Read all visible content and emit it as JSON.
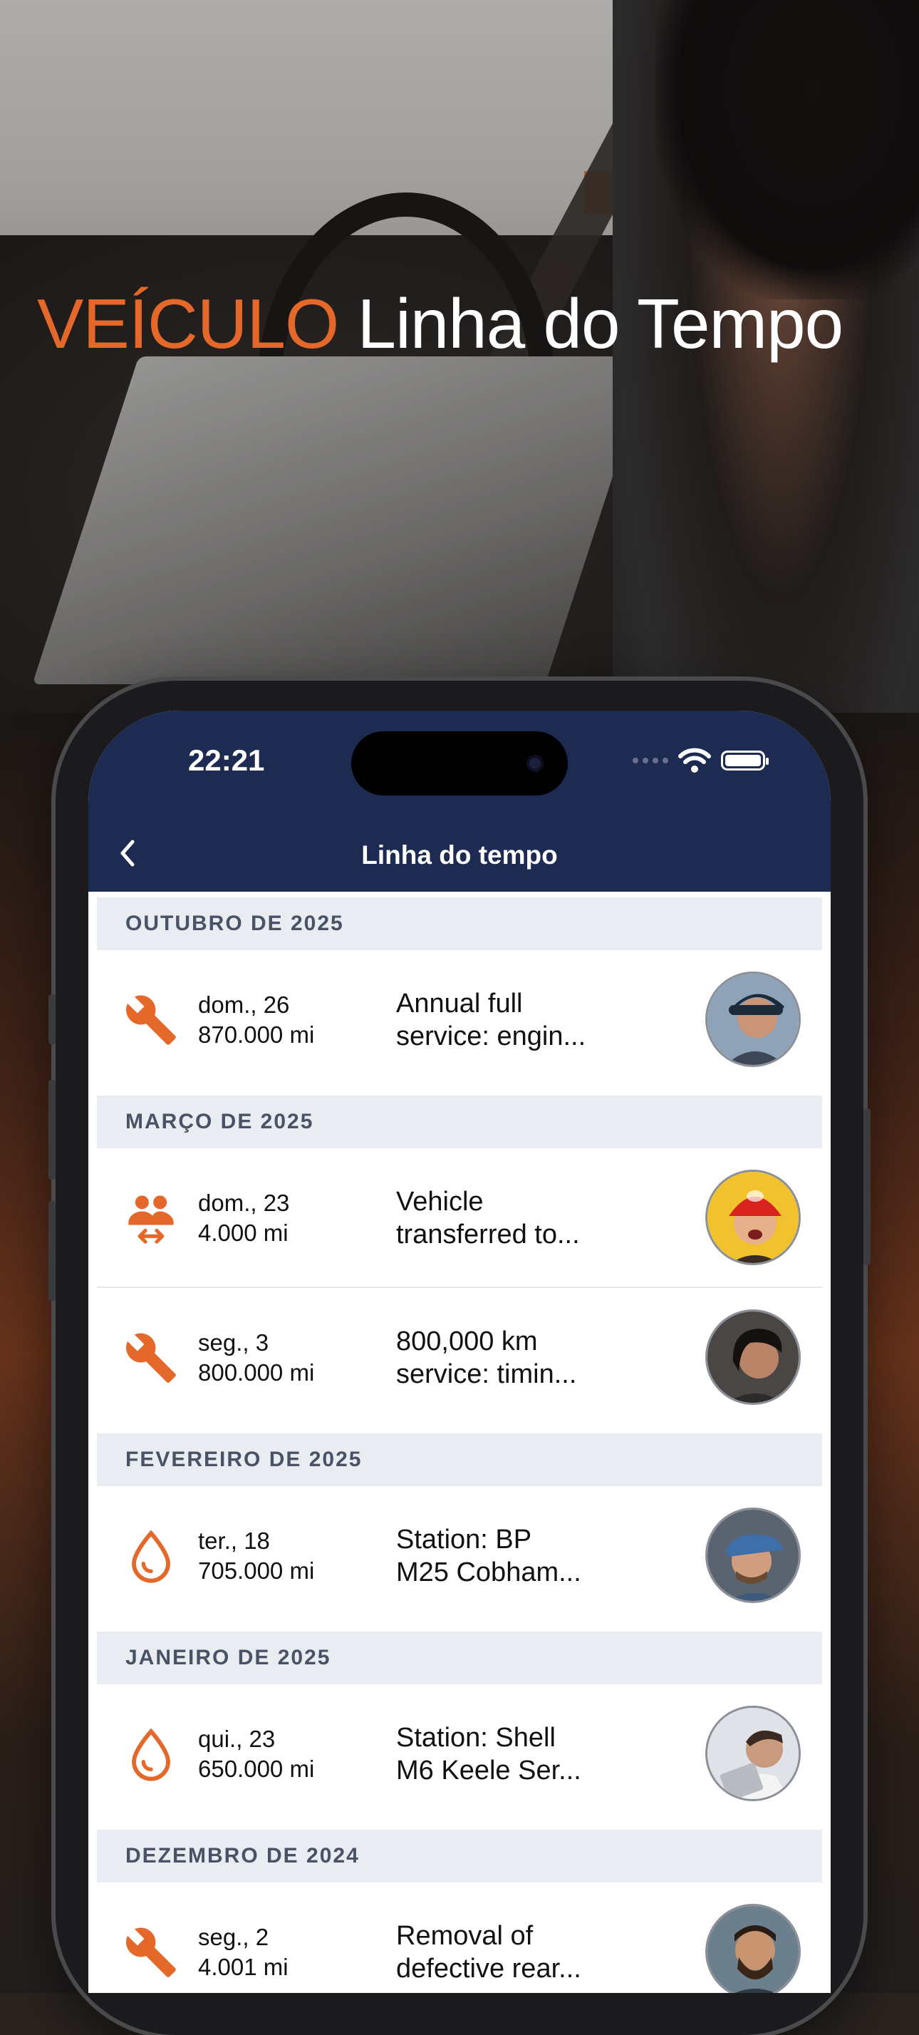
{
  "headline": {
    "accent": "VEÍCULO",
    "rest": "Linha do Tempo"
  },
  "status_bar": {
    "time": "22:21"
  },
  "nav": {
    "title": "Linha do tempo"
  },
  "colors": {
    "accent": "#e5682b",
    "nav_bg": "#1d2a52",
    "section_bg": "#e9ecf1"
  },
  "sections": [
    {
      "label": "OUTUBRO DE 2025",
      "entries": [
        {
          "icon": "wrench-icon",
          "date": "dom., 26",
          "mileage": "870.000 mi",
          "line1": "Annual full",
          "line2": "service: engin..."
        }
      ]
    },
    {
      "label": "MARÇO DE 2025",
      "entries": [
        {
          "icon": "transfer-owners-icon",
          "date": "dom., 23",
          "mileage": "4.000 mi",
          "line1": "Vehicle",
          "line2": "transferred to..."
        },
        {
          "icon": "wrench-icon",
          "date": "seg., 3",
          "mileage": "800.000 mi",
          "line1": "800,000 km",
          "line2": "service: timin..."
        }
      ]
    },
    {
      "label": "FEVEREIRO DE 2025",
      "entries": [
        {
          "icon": "fuel-drop-icon",
          "date": "ter., 18",
          "mileage": "705.000 mi",
          "line1": "Station: BP",
          "line2": "M25 Cobham..."
        }
      ]
    },
    {
      "label": "JANEIRO DE 2025",
      "entries": [
        {
          "icon": "fuel-drop-icon",
          "date": "qui., 23",
          "mileage": "650.000 mi",
          "line1": "Station: Shell",
          "line2": "M6 Keele Ser..."
        }
      ]
    },
    {
      "label": "DEZEMBRO DE 2024",
      "entries": [
        {
          "icon": "wrench-icon",
          "date": "seg., 2",
          "mileage": "4.001 mi",
          "line1": "Removal of",
          "line2": "defective rear..."
        }
      ]
    }
  ]
}
